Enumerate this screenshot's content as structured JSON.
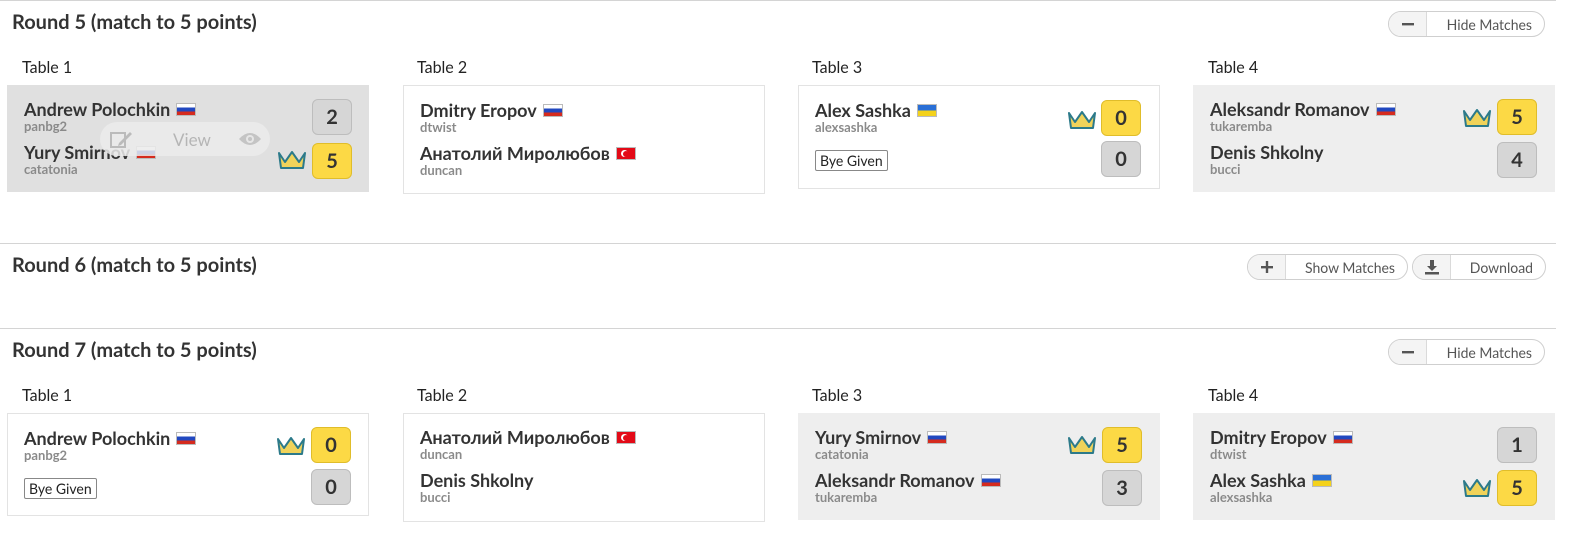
{
  "rounds": [
    {
      "title": "Round 5 (match to 5 points)",
      "toggle_label": "Hide Matches",
      "toggle_icon": "minus-icon",
      "tables": [
        {
          "label": "Table 1",
          "players": [
            {
              "name": "Andrew Polochkin",
              "user": "panbg2",
              "flag": "ru",
              "score": "2",
              "winner": false
            },
            {
              "name": "Yury Smirnov",
              "user": "catatonia",
              "flag": "ru",
              "score": "5",
              "winner": true
            }
          ],
          "hover_overlay": {
            "edit_icon": "edit-icon",
            "view_label": "View",
            "eye_icon": "eye-icon"
          }
        },
        {
          "label": "Table 2",
          "players": [
            {
              "name": "Dmitry Eropov",
              "user": "dtwist",
              "flag": "ru",
              "score": "",
              "winner": false
            },
            {
              "name": "Анатолий Миролюбов",
              "user": "duncan",
              "flag": "tr",
              "score": "",
              "winner": false
            }
          ]
        },
        {
          "label": "Table 3",
          "players": [
            {
              "name": "Alex Sashka",
              "user": "alexsashka",
              "flag": "ua",
              "score": "0",
              "winner": true
            }
          ],
          "bye_label": "Bye Given",
          "bye_score": "0"
        },
        {
          "label": "Table 4",
          "players": [
            {
              "name": "Aleksandr Romanov",
              "user": "tukaremba",
              "flag": "ru",
              "score": "5",
              "winner": true
            },
            {
              "name": "Denis Shkolny",
              "user": "bucci",
              "flag": "",
              "score": "4",
              "winner": false
            }
          ]
        }
      ]
    },
    {
      "title": "Round 6 (match to 5 points)",
      "toggle_label": "Show Matches",
      "toggle_icon": "plus-icon",
      "download_label": "Download",
      "download_icon": "download-icon"
    },
    {
      "title": "Round 7 (match to 5 points)",
      "toggle_label": "Hide Matches",
      "toggle_icon": "minus-icon",
      "tables": [
        {
          "label": "Table 1",
          "players": [
            {
              "name": "Andrew Polochkin",
              "user": "panbg2",
              "flag": "ru",
              "score": "0",
              "winner": true
            }
          ],
          "bye_label": "Bye Given",
          "bye_score": "0"
        },
        {
          "label": "Table 2",
          "players": [
            {
              "name": "Анатолий Миролюбов",
              "user": "duncan",
              "flag": "tr",
              "score": "",
              "winner": false
            },
            {
              "name": "Denis Shkolny",
              "user": "bucci",
              "flag": "",
              "score": "",
              "winner": false
            }
          ]
        },
        {
          "label": "Table 3",
          "players": [
            {
              "name": "Yury Smirnov",
              "user": "catatonia",
              "flag": "ru",
              "score": "5",
              "winner": true
            },
            {
              "name": "Aleksandr Romanov",
              "user": "tukaremba",
              "flag": "ru",
              "score": "3",
              "winner": false
            }
          ]
        },
        {
          "label": "Table 4",
          "players": [
            {
              "name": "Dmitry Eropov",
              "user": "dtwist",
              "flag": "ru",
              "score": "1",
              "winner": false
            },
            {
              "name": "Alex Sashka",
              "user": "alexsashka",
              "flag": "ua",
              "score": "5",
              "winner": true
            }
          ]
        }
      ]
    }
  ],
  "colors": {
    "winner_score": "#fcd945",
    "loser_score": "#d6d6d6",
    "crown": "#e8c43a",
    "crown_outline": "#2c7a8a"
  }
}
